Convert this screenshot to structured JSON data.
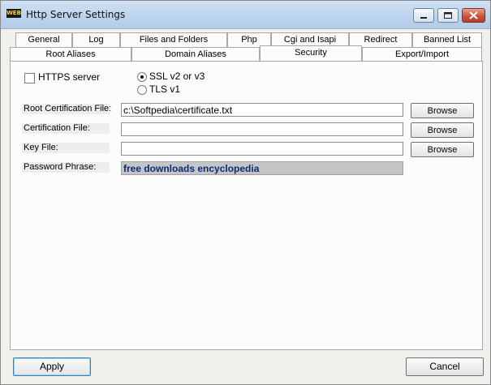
{
  "window": {
    "title": "Http Server Settings",
    "app_icon": "WEB"
  },
  "tabs_row1": [
    "General",
    "Log",
    "Files and Folders",
    "Php",
    "Cgi and Isapi",
    "Redirect",
    "Banned List"
  ],
  "tabs_row2": [
    "Root Aliases",
    "Domain Aliases",
    "Security",
    "Export/Import"
  ],
  "active_tab": "Security",
  "security": {
    "https_label": "HTTPS server",
    "https_checked": false,
    "ssl_label": "SSL v2 or v3",
    "tls_label": "TLS v1",
    "selected_protocol": "SSL v2 or v3",
    "root_cert_label": "Root Certification File:",
    "root_cert_value": "c:\\Softpedia\\certificate.txt",
    "cert_label": "Certification File:",
    "cert_value": "",
    "key_label": "Key File:",
    "key_value": "",
    "password_label": "Password Phrase:",
    "password_value": "free downloads encyclopedia",
    "browse_label": "Browse"
  },
  "footer": {
    "apply_label": "Apply",
    "cancel_label": "Cancel"
  }
}
